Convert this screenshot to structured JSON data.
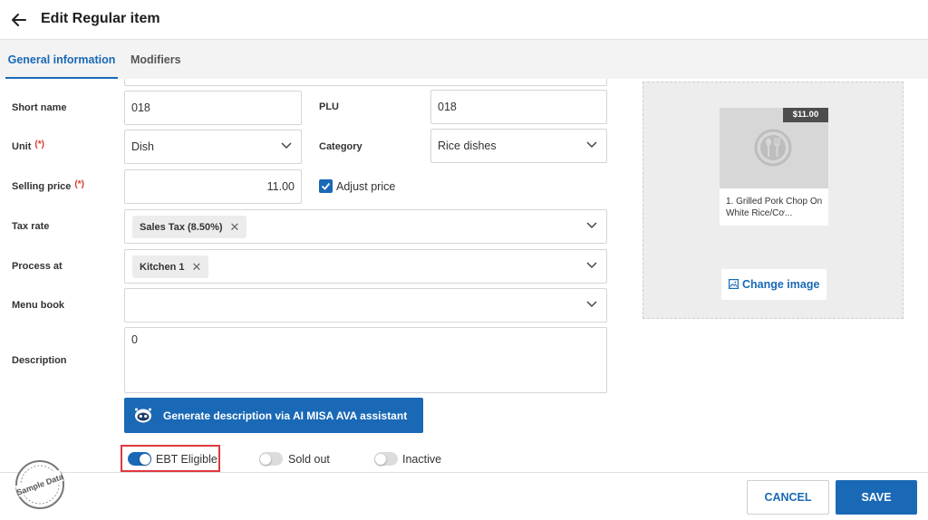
{
  "header": {
    "title": "Edit Regular item"
  },
  "tabs": [
    {
      "label": "General information",
      "active": true
    },
    {
      "label": "Modifiers",
      "active": false
    }
  ],
  "form": {
    "short_name": {
      "label": "Short name",
      "value": "018"
    },
    "plu": {
      "label": "PLU",
      "value": "018"
    },
    "unit": {
      "label": "Unit",
      "required": "(*)",
      "value": "Dish"
    },
    "category": {
      "label": "Category",
      "value": "Rice dishes"
    },
    "selling_price": {
      "label": "Selling price",
      "required": "(*)",
      "value": "11.00"
    },
    "adjust_price": {
      "label": "Adjust price",
      "checked": true
    },
    "tax_rate": {
      "label": "Tax rate",
      "chips": [
        "Sales Tax (8.50%)"
      ]
    },
    "process_at": {
      "label": "Process at",
      "chips": [
        "Kitchen 1"
      ]
    },
    "menu_book": {
      "label": "Menu book",
      "value": ""
    },
    "description": {
      "label": "Description",
      "value": "0"
    },
    "ai_button": {
      "label": "Generate description via AI MISA AVA assistant"
    }
  },
  "toggles": [
    {
      "label": "EBT Eligible",
      "on": true
    },
    {
      "label": "Sold out",
      "on": false
    },
    {
      "label": "Inactive",
      "on": false
    }
  ],
  "image_panel": {
    "price": "$11.00",
    "item_name": "1. Grilled Pork Chop On White Rice/Cơ...",
    "change_label": "Change image"
  },
  "footer": {
    "cancel_label": "CANCEL",
    "save_label": "SAVE"
  },
  "watermark": {
    "text": "Sample Data"
  },
  "colors": {
    "accent": "#1a69b6",
    "required": "#d9372e",
    "highlight": "#e0383f"
  }
}
